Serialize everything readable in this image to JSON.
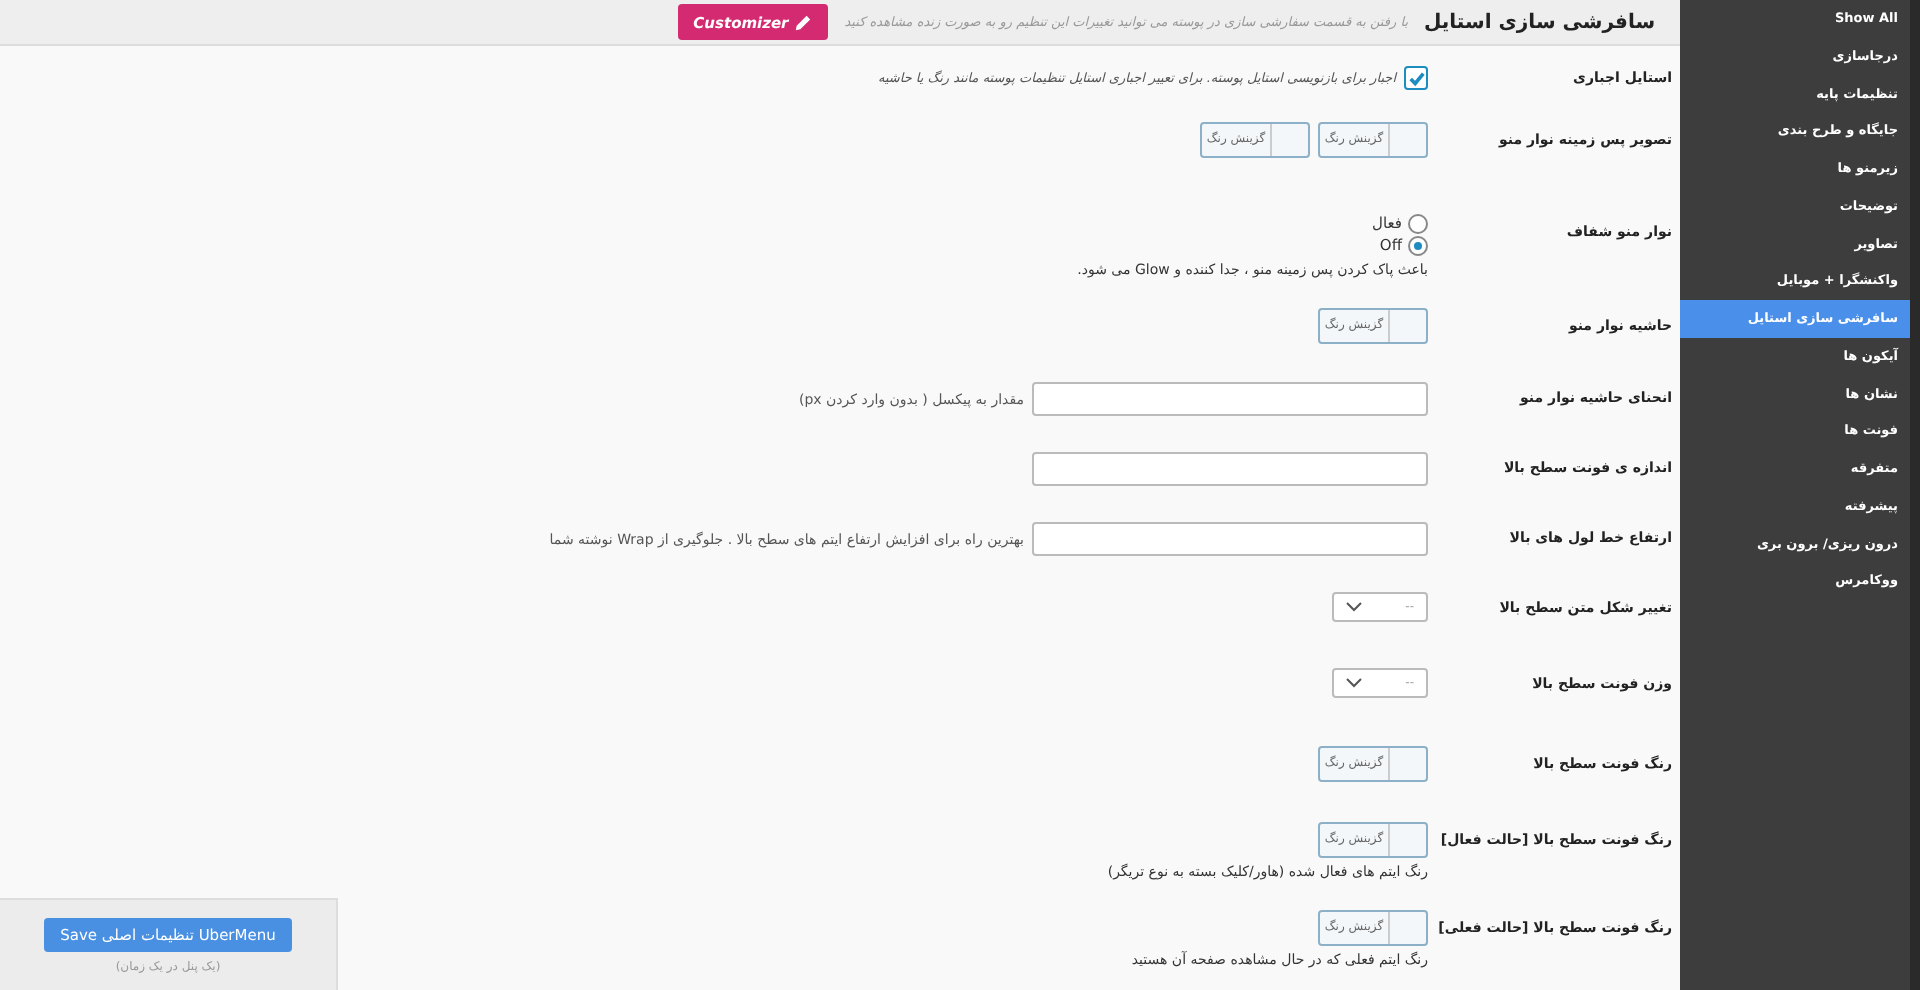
{
  "header": {
    "title": "سافرشی سازی استایل",
    "description": "با رفتن به قسمت سفارشی سازی در پوسته می توانید تغییرات این تنظیم رو به صورت زنده مشاهده کنید",
    "customizer_button": "Customizer"
  },
  "sidebar": {
    "items": [
      {
        "label": "Show All",
        "selected": false
      },
      {
        "label": "درجاسازی",
        "selected": false
      },
      {
        "label": "تنظیمات پایه",
        "selected": false
      },
      {
        "label": "جایگاه و طرح بندی",
        "selected": false
      },
      {
        "label": "زیرمنو ها",
        "selected": false
      },
      {
        "label": "توضیحات",
        "selected": false
      },
      {
        "label": "تصاویر",
        "selected": false
      },
      {
        "label": "واکنشگرا + موبایل",
        "selected": false
      },
      {
        "label": "سافرشی سازی استایل",
        "selected": true
      },
      {
        "label": "آیکون ها",
        "selected": false
      },
      {
        "label": "نشان ها",
        "selected": false
      },
      {
        "label": "فونت ها",
        "selected": false
      },
      {
        "label": "متفرقه",
        "selected": false
      },
      {
        "label": "پیشرفته",
        "selected": false
      },
      {
        "label": "درون ریزی/ برون بری",
        "selected": false
      },
      {
        "label": "ووکامرس",
        "selected": false
      }
    ]
  },
  "settings": [
    {
      "label": "استایل اجباری",
      "kind": "checkbox",
      "checked": true,
      "text": "اجبار برای بازنویسی استایل پوسته. برای تعییر اجباری استایل تنظیمات پوسته مانند رنگ یا حاشیه"
    },
    {
      "label": "تصویر پس زمینه نوار منو",
      "kind": "color",
      "pickers": [
        "گزینش رنگ",
        "گزینش رنگ"
      ]
    },
    {
      "label": "نوار منو شفاف",
      "kind": "radio",
      "options": [
        {
          "label": "فعال",
          "selected": false
        },
        {
          "label": "Off",
          "selected": true
        }
      ],
      "description": "باعث پاک کردن پس زمینه منو ، جدا کننده و Glow می شود."
    },
    {
      "label": "حاشیه نوار منو",
      "kind": "color",
      "pickers": [
        "گزینش رنگ"
      ]
    },
    {
      "label": "انحنای حاشیه نوار منو",
      "kind": "text",
      "description": "مقدار به پیکسل ( بدون وارد کردن px)"
    },
    {
      "label": "اندازه ی فونت سطح بالا",
      "kind": "text"
    },
    {
      "label": "ارتفاع خط لول های بالا",
      "kind": "text",
      "description": "بهترین راه برای افزایش ارتفاع ایتم های سطح بالا . جلوگیری از Wrap نوشته شما"
    },
    {
      "label": "تغییر شکل متن سطح بالا",
      "kind": "select",
      "value": "--"
    },
    {
      "label": "وزن فونت سطح بالا",
      "kind": "select",
      "value": "--"
    },
    {
      "label": "رنگ فونت سطح بالا",
      "kind": "color",
      "pickers": [
        "گزینش رنگ"
      ]
    },
    {
      "label": "رنگ فونت سطح بالا [حالت فعال]",
      "kind": "color",
      "pickers": [
        "گزینش رنگ"
      ],
      "description": "رنگ ایتم های فعال شده (هاور/کلیک بسته به نوع تریگر)"
    },
    {
      "label": "رنگ فونت سطح بالا [حالت فعلی]",
      "kind": "color",
      "pickers": [
        "گزینش رنگ"
      ],
      "description": "رنگ ایتم فعلی که در حال مشاهده صفحه آن هستید"
    }
  ],
  "save_panel": {
    "button": "Save تنظیمات اصلی UberMenu",
    "note": "(یک پنل در یک زمان)"
  }
}
